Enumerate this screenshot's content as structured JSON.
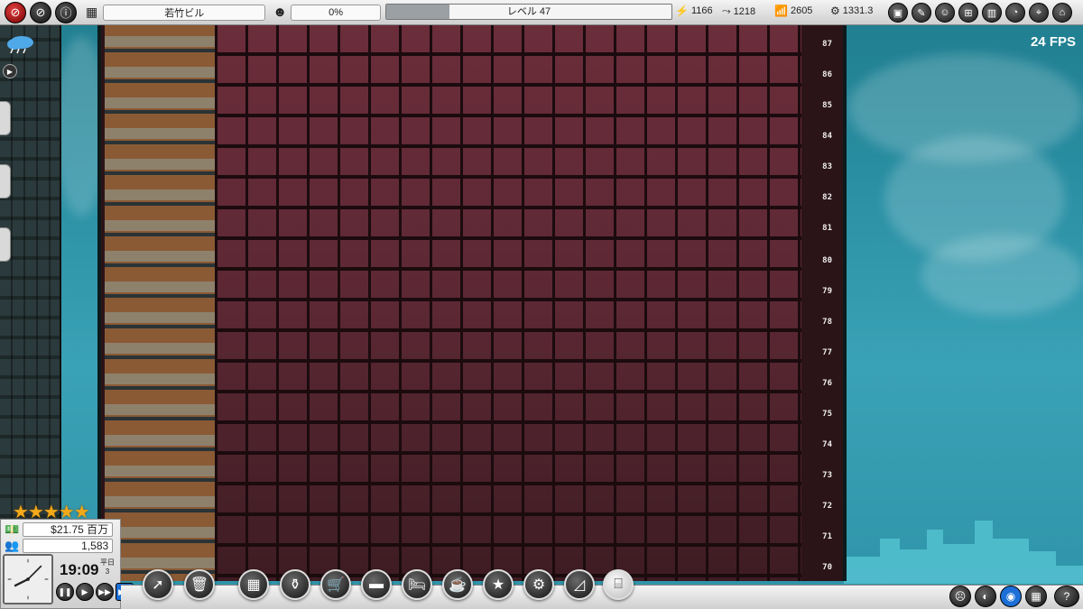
{
  "topbar": {
    "building_name": "若竹ビル",
    "satisfaction": "0%",
    "level_label": "レベル 47",
    "level_progress": 0.22,
    "power": "1166",
    "water": "1218",
    "signal": "2605",
    "heat": "1331.3"
  },
  "fps": "24 FPS",
  "floors": [
    "87",
    "86",
    "85",
    "84",
    "83",
    "82",
    "81",
    "80",
    "79",
    "78",
    "77",
    "76",
    "75",
    "74",
    "73",
    "72",
    "71",
    "70"
  ],
  "panel": {
    "rating_stars": 5,
    "stars_text": "★★★★★",
    "money": "$21.75 百万",
    "population": "1,583",
    "time": "19:09",
    "day_type": "平日",
    "day_number": "3"
  },
  "icons": {
    "left_top": [
      "no-entry-icon",
      "info-icon"
    ],
    "bottom_tools": [
      "cursor-icon",
      "trash-icon",
      "add-room-icon",
      "mop-bucket-icon",
      "cart-icon",
      "sofa-icon",
      "bed-icon",
      "coffee-icon",
      "stars-icon",
      "gear-icon",
      "stairs-icon",
      "lantern-icon"
    ],
    "bottom_right": [
      "sad-face-icon",
      "contrast-icon",
      "eye-icon",
      "grid-icon",
      "help-icon"
    ]
  },
  "colors": {
    "sky": "#2a8fa3",
    "room_wall": "#6b2d3a",
    "star": "#f2a91a",
    "active_speed": "#1c6fd6"
  }
}
